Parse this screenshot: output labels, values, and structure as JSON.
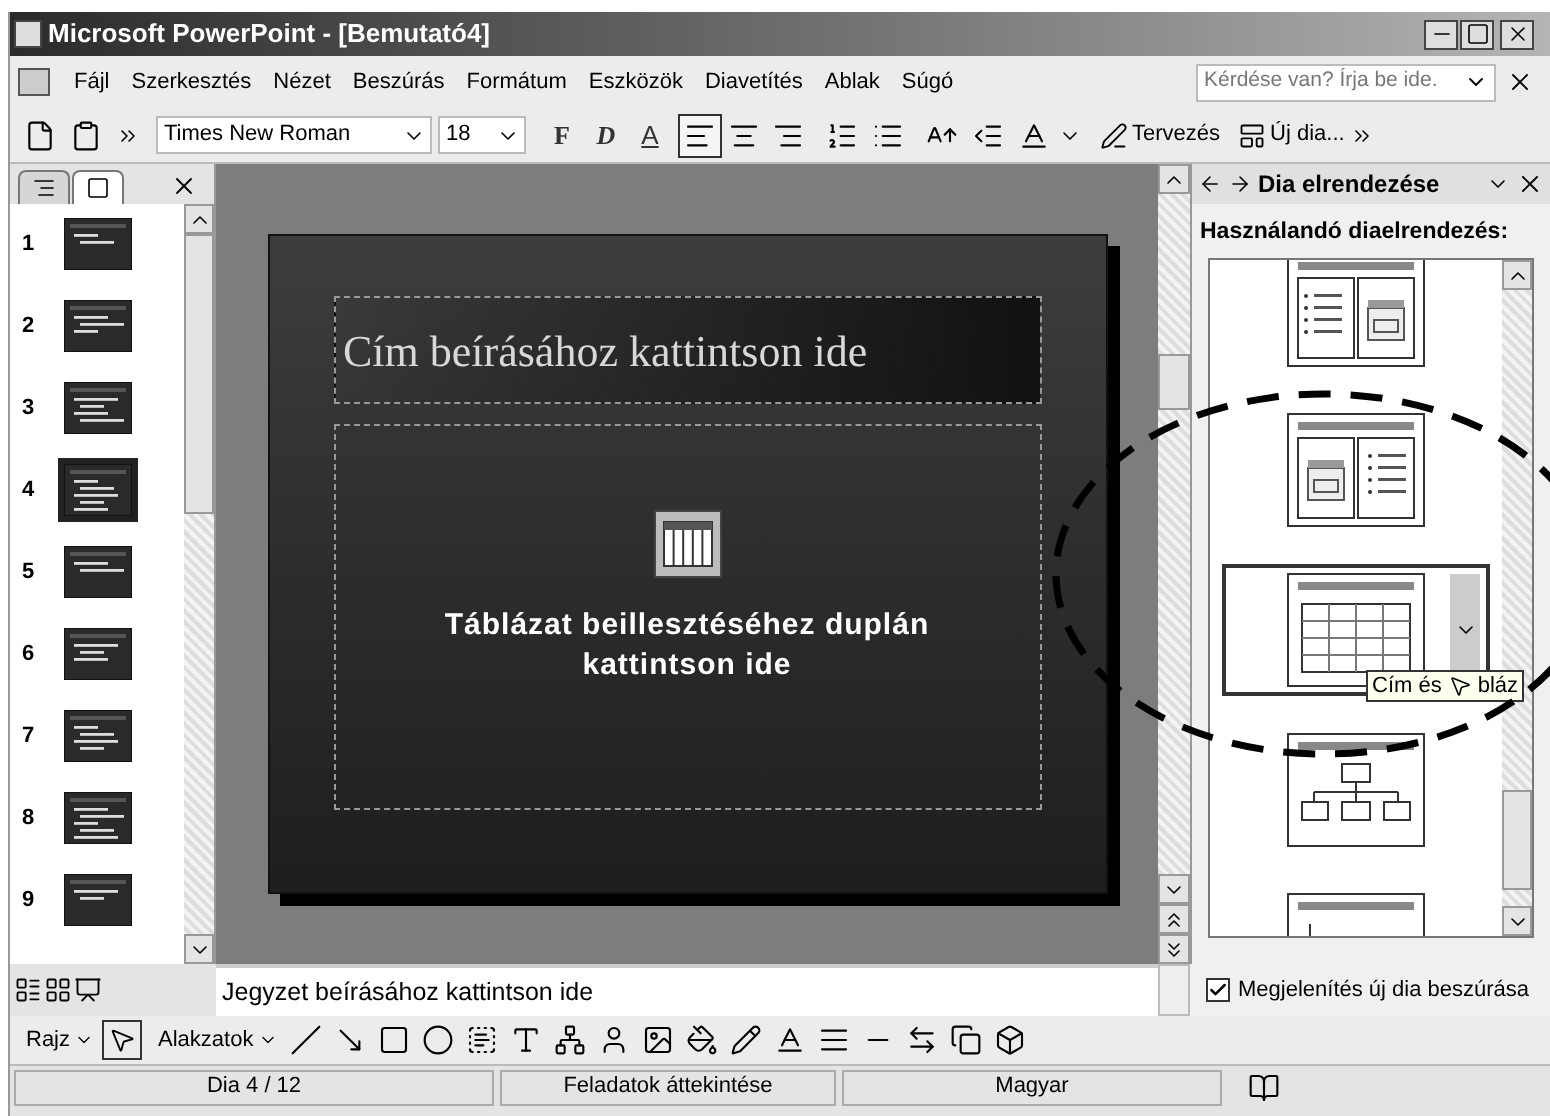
{
  "window": {
    "title": "Microsoft PowerPoint - [Bemutató4]"
  },
  "menu": [
    "Fájl",
    "Szerkesztés",
    "Nézet",
    "Beszúrás",
    "Formátum",
    "Eszközök",
    "Diavetítés",
    "Ablak",
    "Súgó"
  ],
  "help_search": {
    "placeholder": "Kérdése van? Írja be ide."
  },
  "toolbar": {
    "font": "Times New Roman",
    "size": "18",
    "format_buttons": [
      {
        "label": "F",
        "kind": "bold"
      },
      {
        "label": "D",
        "kind": "italic"
      },
      {
        "label": "A",
        "kind": "underline"
      }
    ],
    "align": [
      {
        "selected": true
      },
      {
        "selected": false
      },
      {
        "selected": false
      }
    ],
    "design": "Tervezés",
    "new_slide": "Új dia..."
  },
  "slides_pane": {
    "tabs": [
      {
        "kind": "outline",
        "selected": false
      },
      {
        "kind": "slides",
        "selected": true
      }
    ],
    "slides": [
      {
        "number": "1",
        "selected": false
      },
      {
        "number": "2",
        "selected": false
      },
      {
        "number": "3",
        "selected": false
      },
      {
        "number": "4",
        "selected": true
      },
      {
        "number": "5",
        "selected": false
      },
      {
        "number": "6",
        "selected": false
      },
      {
        "number": "7",
        "selected": false
      },
      {
        "number": "8",
        "selected": false
      },
      {
        "number": "9",
        "selected": false
      }
    ]
  },
  "slide": {
    "title_placeholder": "Cím beírásához kattintson ide",
    "body_placeholder": "Táblázat beillesztéséhez duplán kattintson ide"
  },
  "task_pane": {
    "title": "Dia elrendezése",
    "heading": "Használandó diaelrendezés:",
    "layouts": [
      {
        "kind": "text-chart",
        "selected": false
      },
      {
        "kind": "chart-text",
        "selected": false
      },
      {
        "kind": "table",
        "selected": true
      },
      {
        "kind": "org-chart",
        "selected": false
      },
      {
        "kind": "chart",
        "selected": false
      }
    ],
    "tooltip": [
      "Cím és",
      "bláz"
    ],
    "show_on_insert": {
      "label": "Megjelenítés új dia beszúrása",
      "checked": true
    }
  },
  "notes": {
    "placeholder": "Jegyzet beírásához kattintson ide"
  },
  "drawing_toolbar": {
    "draw": "Rajz",
    "shapes": "Alakzatok"
  },
  "status_bar": [
    "Dia 4 / 12",
    "Feladatok áttekintése",
    "Magyar"
  ]
}
